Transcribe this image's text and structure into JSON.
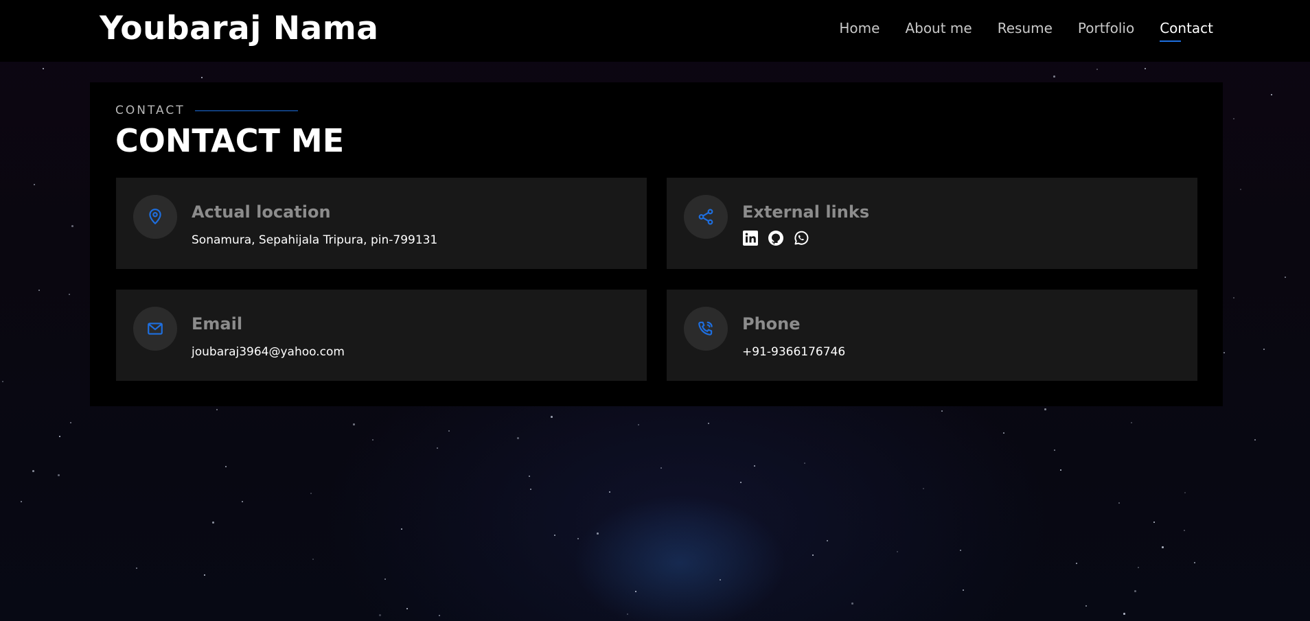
{
  "header": {
    "logo": "Youbaraj Nama",
    "nav": [
      {
        "label": "Home"
      },
      {
        "label": "About me"
      },
      {
        "label": "Resume"
      },
      {
        "label": "Portfolio"
      },
      {
        "label": "Contact",
        "active": true
      }
    ]
  },
  "section": {
    "kicker": "CONTACT",
    "title": "CONTACT ME"
  },
  "cards": {
    "location": {
      "icon": "map-pin-icon",
      "title": "Actual location",
      "text": "Sonamura, Sepahijala Tripura, pin-799131"
    },
    "links": {
      "icon": "share-icon",
      "title": "External links",
      "items": [
        "linkedin-icon",
        "github-icon",
        "whatsapp-icon"
      ]
    },
    "email": {
      "icon": "envelope-icon",
      "title": "Email",
      "text": "joubaraj3964@yahoo.com"
    },
    "phone": {
      "icon": "phone-icon",
      "title": "Phone",
      "text": "+91-9366176746"
    }
  },
  "colors": {
    "accent": "#1e6fe0",
    "background": "#000000",
    "card": "#181818",
    "muted_title": "#8c8c8c"
  }
}
